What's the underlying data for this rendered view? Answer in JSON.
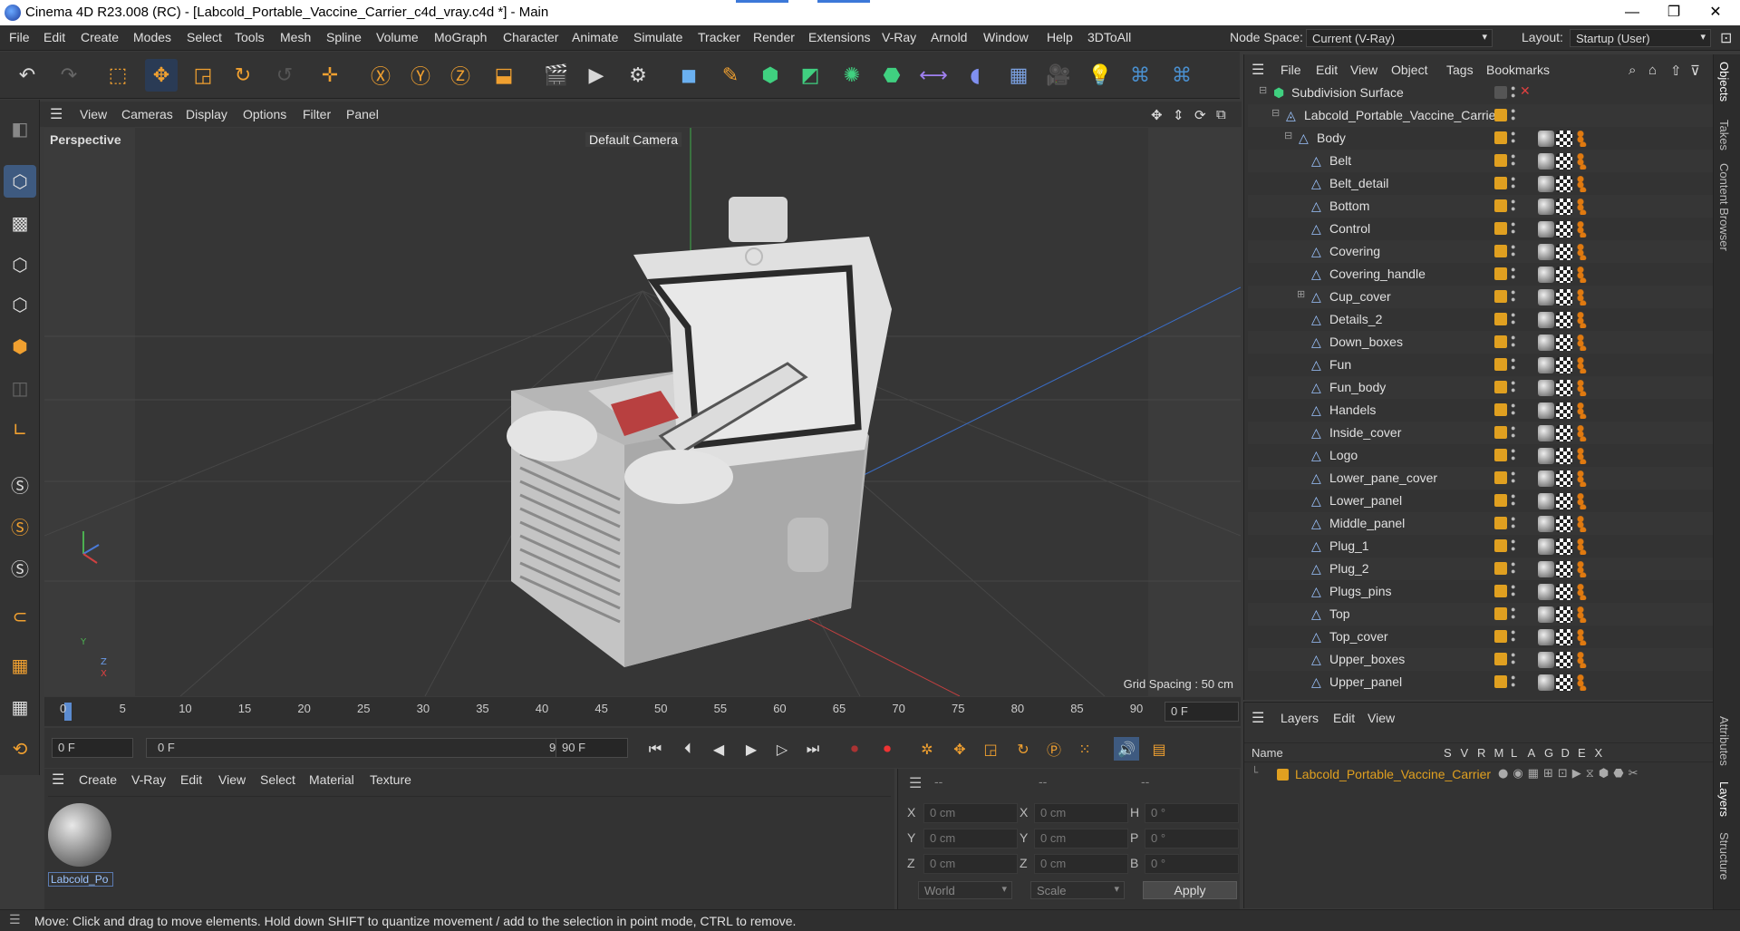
{
  "window": {
    "title": "Cinema 4D R23.008 (RC) - [Labcold_Portable_Vaccine_Carrier_c4d_vray.c4d *] - Main",
    "controls": [
      "—",
      "❐",
      "✕"
    ]
  },
  "menubar": {
    "items": [
      "File",
      "Edit",
      "Create",
      "Modes",
      "Select",
      "Tools",
      "Mesh",
      "Spline",
      "Volume",
      "MoGraph",
      "Character",
      "Animate",
      "Simulate",
      "Tracker",
      "Render",
      "Extensions",
      "V-Ray",
      "Arnold",
      "Window",
      "Help",
      "3DToAll"
    ],
    "node_space_label": "Node Space:",
    "node_space_value": "Current (V-Ray)",
    "layout_label": "Layout:",
    "layout_value": "Startup (User)"
  },
  "viewport": {
    "menu": [
      "View",
      "Cameras",
      "Display",
      "Options",
      "Filter",
      "Panel"
    ],
    "projection": "Perspective",
    "camera": "Default Camera",
    "grid_spacing": "Grid Spacing : 50 cm",
    "axis_labels": {
      "y": "Y",
      "z": "Z",
      "x": "X"
    }
  },
  "timeline": {
    "ticks": [
      "0",
      "5",
      "10",
      "15",
      "20",
      "25",
      "30",
      "35",
      "40",
      "45",
      "50",
      "55",
      "60",
      "65",
      "70",
      "75",
      "80",
      "85",
      "90"
    ],
    "current_frame": "0 F"
  },
  "playback": {
    "start": "0 F",
    "range_start": "0 F",
    "range_end": "90 F",
    "end": "90 F"
  },
  "material_panel": {
    "menu": [
      "Create",
      "V-Ray",
      "Edit",
      "View",
      "Select",
      "Material",
      "Texture"
    ],
    "materials": [
      {
        "name": "Labcold_Po"
      }
    ]
  },
  "coordinates": {
    "headers": [
      "--",
      "--",
      "--"
    ],
    "rows": [
      {
        "l1": "X",
        "v1": "0 cm",
        "l2": "X",
        "v2": "0 cm",
        "l3": "H",
        "v3": "0 °"
      },
      {
        "l1": "Y",
        "v1": "0 cm",
        "l2": "Y",
        "v2": "0 cm",
        "l3": "P",
        "v3": "0 °"
      },
      {
        "l1": "Z",
        "v1": "0 cm",
        "l2": "Z",
        "v2": "0 cm",
        "l3": "B",
        "v3": "0 °"
      }
    ],
    "space": "World",
    "mode": "Scale",
    "apply": "Apply"
  },
  "object_manager": {
    "menu": [
      "File",
      "Edit",
      "View",
      "Object",
      "Tags",
      "Bookmarks"
    ],
    "objects": [
      {
        "name": "Subdivision Surface",
        "depth": 0,
        "kind": "subd"
      },
      {
        "name": "Labcold_Portable_Vaccine_Carrier",
        "depth": 1,
        "kind": "null"
      },
      {
        "name": "Body",
        "depth": 2,
        "kind": "poly"
      },
      {
        "name": "Belt",
        "depth": 3,
        "kind": "poly"
      },
      {
        "name": "Belt_detail",
        "depth": 3,
        "kind": "poly"
      },
      {
        "name": "Bottom",
        "depth": 3,
        "kind": "poly"
      },
      {
        "name": "Control",
        "depth": 3,
        "kind": "poly"
      },
      {
        "name": "Covering",
        "depth": 3,
        "kind": "poly"
      },
      {
        "name": "Covering_handle",
        "depth": 3,
        "kind": "poly"
      },
      {
        "name": "Cup_cover",
        "depth": 3,
        "kind": "poly"
      },
      {
        "name": "Details_2",
        "depth": 3,
        "kind": "poly"
      },
      {
        "name": "Down_boxes",
        "depth": 3,
        "kind": "poly"
      },
      {
        "name": "Fun",
        "depth": 3,
        "kind": "poly"
      },
      {
        "name": "Fun_body",
        "depth": 3,
        "kind": "poly"
      },
      {
        "name": "Handels",
        "depth": 3,
        "kind": "poly"
      },
      {
        "name": "Inside_cover",
        "depth": 3,
        "kind": "poly"
      },
      {
        "name": "Logo",
        "depth": 3,
        "kind": "poly"
      },
      {
        "name": "Lower_pane_cover",
        "depth": 3,
        "kind": "poly"
      },
      {
        "name": "Lower_panel",
        "depth": 3,
        "kind": "poly"
      },
      {
        "name": "Middle_panel",
        "depth": 3,
        "kind": "poly"
      },
      {
        "name": "Plug_1",
        "depth": 3,
        "kind": "poly"
      },
      {
        "name": "Plug_2",
        "depth": 3,
        "kind": "poly"
      },
      {
        "name": "Plugs_pins",
        "depth": 3,
        "kind": "poly"
      },
      {
        "name": "Top",
        "depth": 3,
        "kind": "poly"
      },
      {
        "name": "Top_cover",
        "depth": 3,
        "kind": "poly"
      },
      {
        "name": "Upper_boxes",
        "depth": 3,
        "kind": "poly"
      },
      {
        "name": "Upper_panel",
        "depth": 3,
        "kind": "poly"
      }
    ]
  },
  "layer_manager": {
    "menu": [
      "Layers",
      "Edit",
      "View"
    ],
    "columns": [
      "Name",
      "S",
      "V",
      "R",
      "M",
      "L",
      "A",
      "G",
      "D",
      "E",
      "X"
    ],
    "layers": [
      {
        "name": "Labcold_Portable_Vaccine_Carrier",
        "color": "#e0a020"
      }
    ]
  },
  "side_tabs": [
    "Objects",
    "Takes",
    "Content Browser",
    "Attributes",
    "Layers",
    "Structure"
  ],
  "status": "Move: Click and drag to move elements. Hold down SHIFT to quantize movement / add to the selection in point mode, CTRL to remove."
}
